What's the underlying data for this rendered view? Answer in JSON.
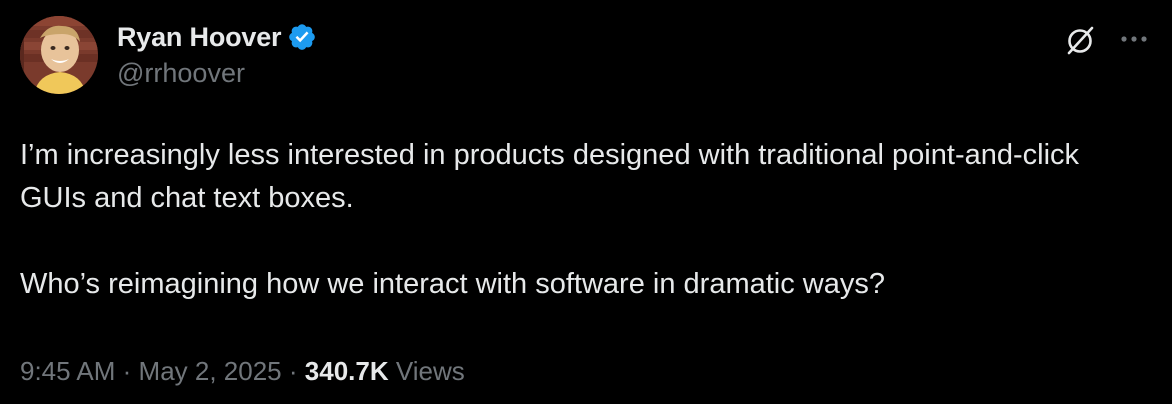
{
  "author": {
    "display_name": "Ryan Hoover",
    "handle": "@rrhoover",
    "verified_icon": "verified-badge-icon"
  },
  "actions": {
    "grok_icon": "grok-icon",
    "more_icon": "more-dots-icon"
  },
  "tweet": {
    "text_line1": "I’m increasingly less interested in products designed with traditional point-and-click GUIs and chat text boxes.",
    "text_line2": "Who’s reimagining how we interact with software in dramatic ways?"
  },
  "meta": {
    "time": "9:45 AM",
    "separator": "·",
    "date": "May 2, 2025",
    "views_count": "340.7K",
    "views_label": "Views"
  },
  "colors": {
    "background": "#000000",
    "primary_text": "#e7e9ea",
    "secondary_text": "#71767b",
    "verified_blue": "#1d9bf0"
  }
}
